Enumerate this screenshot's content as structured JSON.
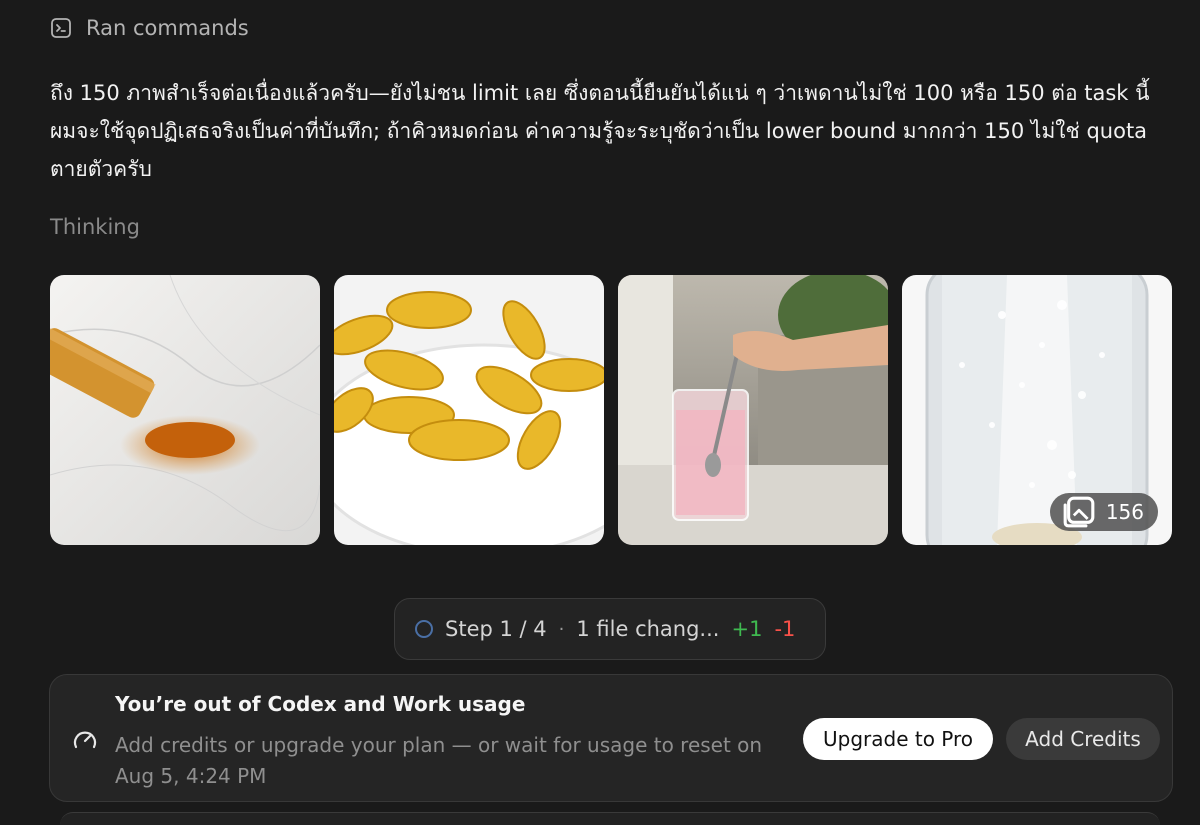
{
  "ran_commands": {
    "label": "Ran commands",
    "icon": "terminal-icon"
  },
  "message": "ถึง 150 ภาพสำเร็จต่อเนื่องแล้วครับ—ยังไม่ชน limit เลย ซึ่งตอนนี้ยืนยันได้แน่ ๆ ว่าเพดานไม่ใช่ 100 หรือ 150 ต่อ task นี้ ผมจะใช้จุดปฏิเสธจริงเป็นค่าที่บันทึก; ถ้าคิวหมดก่อน ค่าความรู้จะระบุชัดว่าเป็น lower bound มากกว่า 150 ไม่ใช่ quota ตายตัวครับ",
  "thinking_label": "Thinking",
  "gallery": {
    "images": [
      {
        "name": "turmeric-powder"
      },
      {
        "name": "fish-oil-capsules"
      },
      {
        "name": "pink-drink-stirring"
      },
      {
        "name": "effervescent-tablet"
      }
    ],
    "count_icon": "images-stack-icon",
    "count": "156"
  },
  "step_status": {
    "step": "Step 1 / 4",
    "separator": "·",
    "files": "1 file chang...",
    "additions": "+1",
    "deletions": "-1"
  },
  "usage_notice": {
    "icon": "gauge-icon",
    "title": "You’re out of Codex and Work usage",
    "description": "Add credits or upgrade your plan — or wait for usage to reset on Aug 5, 4:24 PM",
    "upgrade_label": "Upgrade to Pro",
    "credits_label": "Add Credits"
  },
  "colors": {
    "background": "#1a1a1a",
    "added": "#3fb950",
    "removed": "#f85149"
  }
}
